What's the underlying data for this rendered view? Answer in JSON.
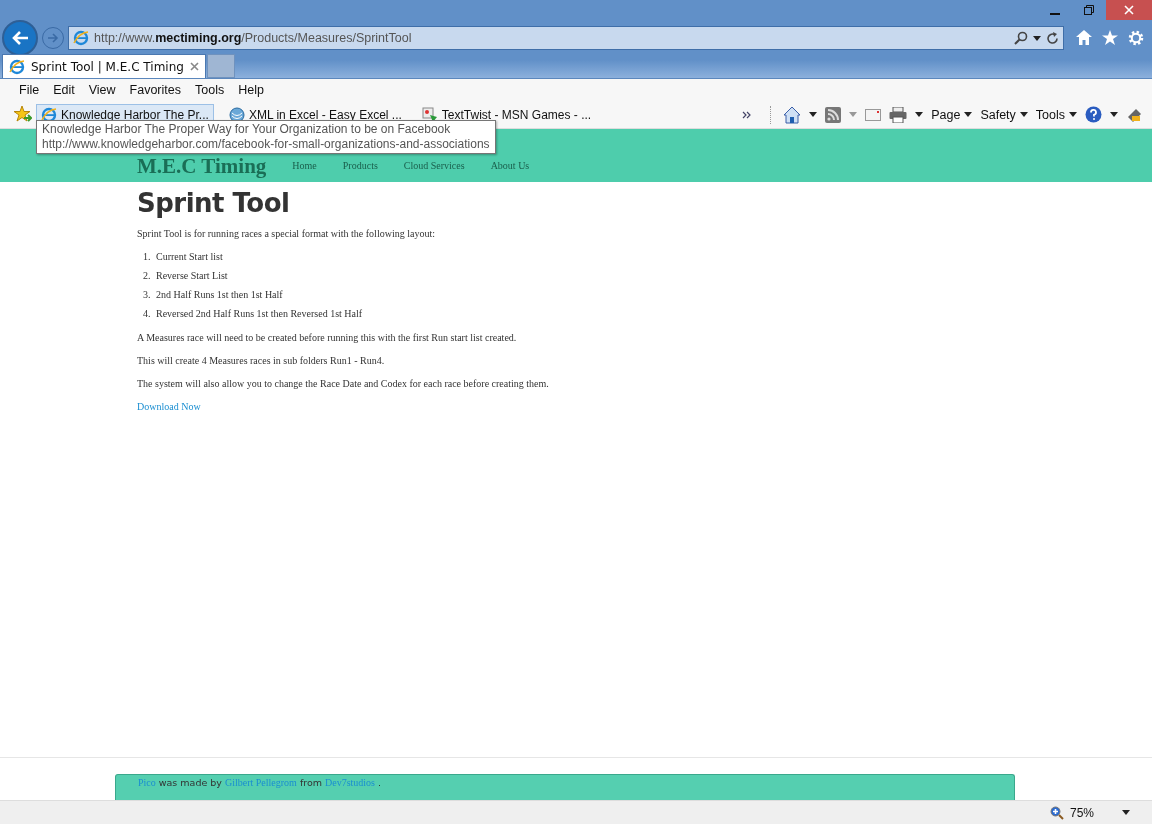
{
  "address_bar": {
    "url": "http://www.**mectiming.org**/Products/Measures/SprintTool"
  },
  "tabs": [
    {
      "title": "Sprint Tool | M.E.C Timing",
      "selected": true
    }
  ],
  "menu": [
    "File",
    "Edit",
    "View",
    "Favorites",
    "Tools",
    "Help"
  ],
  "favorites": [
    {
      "title": "Knowledge Harbor The Pr...",
      "kind": "ie",
      "selected": true
    },
    {
      "title": "XML in Excel - Easy Excel ...",
      "kind": "globe",
      "selected": false
    },
    {
      "title": "TextTwist - MSN Games - ...",
      "kind": "game",
      "selected": false
    }
  ],
  "command_bar": [
    "Page",
    "Safety",
    "Tools"
  ],
  "tooltip": {
    "title": "Knowledge Harbor The Proper Way for Your Organization to be on Facebook",
    "url": "http://www.knowledgeharbor.com/facebook-for-small-organizations-and-associations"
  },
  "site": {
    "brand": "M.E.C Timing",
    "nav": [
      "Home",
      "Products",
      "Cloud Services",
      "About Us"
    ]
  },
  "content": {
    "heading": "Sprint Tool",
    "intro": "Sprint Tool is for running races a special format with the following layout:",
    "list": [
      {
        "number": "1.",
        "text": "Current Start list"
      },
      {
        "number": "2.",
        "text": "Reverse Start List"
      },
      {
        "number": "3.",
        "text": "2nd Half Runs 1st then 1st Half"
      },
      {
        "number": "4.",
        "text": "Reversed 2nd Half Runs 1st then Reversed 1st Half"
      }
    ],
    "paragraphs": [
      "A Measures race will need to be created before running this with the first Run start list created.",
      "This will create 4 Measures races in sub folders Run1 - Run4.",
      "The system will also allow you to change the Race Date and Codex for each race before creating them."
    ],
    "link": "Download Now"
  },
  "footer": [
    [
      {
        "text": "Pico",
        "kind": "link"
      },
      {
        "text": "was made by",
        "kind": "text"
      },
      {
        "text": "Gilbert Pellegrom",
        "kind": "link"
      },
      {
        "text": "from",
        "kind": "text"
      },
      {
        "text": "Dev7studios",
        "kind": "link"
      },
      {
        "text": ".",
        "kind": "text"
      }
    ]
  ],
  "status_bar": {
    "zoom": "75%"
  }
}
